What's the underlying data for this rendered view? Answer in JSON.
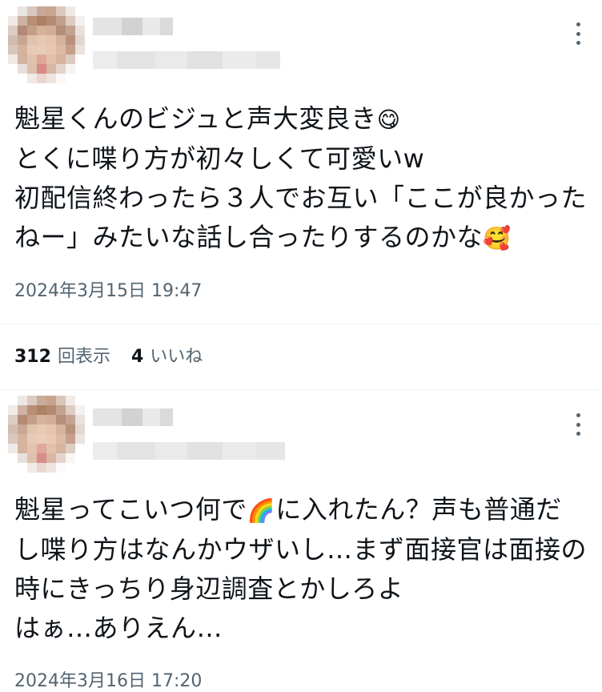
{
  "posts": [
    {
      "body_line1": "魁星くんのビジュと声大変良き",
      "body_emoji1": "😋",
      "body_rest": "とくに喋り方が初々しくて可愛いw\n初配信終わったら３人でお互い「ここが良かった\nねー」みたいな話し合ったりするのかな",
      "body_emoji2": "🥰",
      "timestamp": "2024年3月15日 19:47",
      "views_count": "312",
      "views_label": "回表示",
      "likes_count": "4",
      "likes_label": "いいね"
    },
    {
      "body_line1a": "魁星ってこいつ何で",
      "body_emoji1": "🌈",
      "body_line1b": "に入れたん？声も普通だ",
      "body_rest": "し喋り方はなんかウザいし…まず面接官は面接の\n時にきっちり身辺調査とかしろよ\nはぁ…ありえん…",
      "timestamp": "2024年3月16日 17:20"
    }
  ],
  "colors": {
    "text": "#0f1419",
    "secondary": "#536471",
    "divider": "#eff3f4"
  },
  "icons": {
    "more": "more-vertical-icon"
  }
}
